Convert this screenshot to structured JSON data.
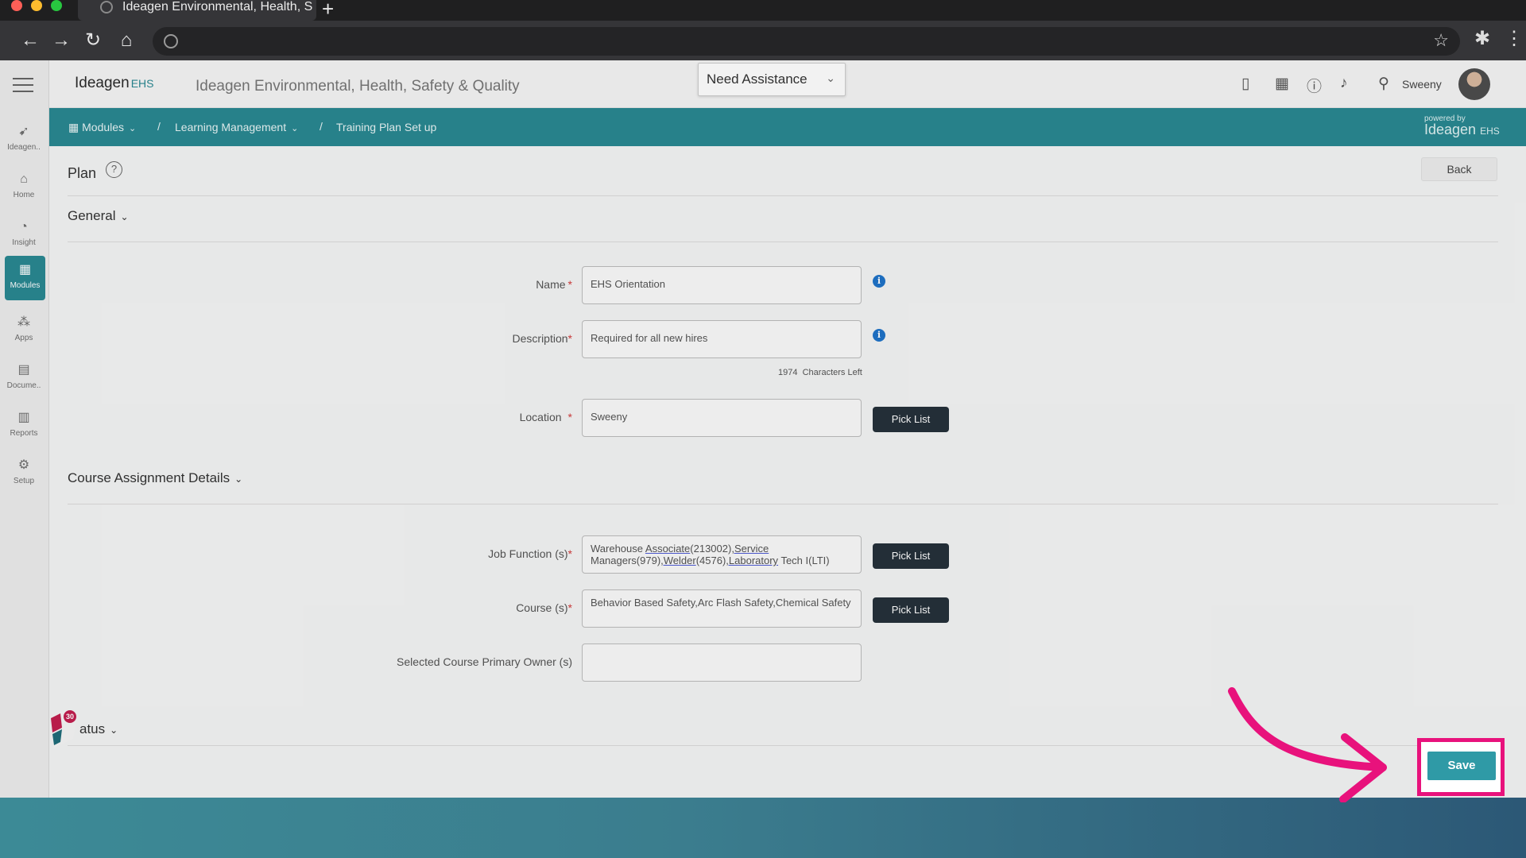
{
  "browser": {
    "tab_title": "Ideagen Environmental, Health, S",
    "new_tab_label": "+"
  },
  "header": {
    "logo_text": "Ideagen",
    "logo_suffix": "EHS",
    "app_title": "Ideagen Environmental, Health, Safety & Quality",
    "assistance_label": "Need Assistance",
    "user_name": "Sweeny"
  },
  "sidebar": {
    "items": [
      {
        "label": "Ideagen..",
        "icon": "ideagen-icon"
      },
      {
        "label": "Home",
        "icon": "home-icon"
      },
      {
        "label": "Insight",
        "icon": "insight-icon"
      },
      {
        "label": "Modules",
        "icon": "modules-icon"
      },
      {
        "label": "Apps",
        "icon": "apps-icon"
      },
      {
        "label": "Docume..",
        "icon": "document-icon"
      },
      {
        "label": "Reports",
        "icon": "reports-icon"
      },
      {
        "label": "Setup",
        "icon": "setup-icon"
      }
    ],
    "active_index": 3
  },
  "breadcrumb": {
    "items": [
      "Modules",
      "Learning Management",
      "Training Plan Set up"
    ],
    "separator": "/",
    "powered_small": "powered by",
    "powered_brand": "Ideagen",
    "powered_suffix": "EHS"
  },
  "page": {
    "title": "Plan",
    "help": "?",
    "back_label": "Back"
  },
  "sections": {
    "general": "General",
    "course_assignment": "Course Assignment Details",
    "status": "atus"
  },
  "form": {
    "name": {
      "label": "Name",
      "value": "EHS Orientation"
    },
    "description": {
      "label": "Description",
      "value": "Required for all new hires",
      "chars_left": "1974",
      "chars_left_label": "Characters Left"
    },
    "location": {
      "label": "Location",
      "value": "Sweeny"
    },
    "job_function": {
      "label": "Job Function (s)",
      "value_parts": [
        "Warehouse ",
        "Associate",
        "(213002)",
        ",Service",
        " Managers(979)",
        ",Welder",
        "(4576)",
        ",Laboratory",
        " Tech I(LTI)"
      ]
    },
    "course": {
      "label": "Course (s)",
      "value": "Behavior Based Safety,Arc Flash Safety,Chemical Safety"
    },
    "primary_owner": {
      "label": "Selected Course Primary Owner (s)",
      "value": ""
    },
    "pick_list_label": "Pick List",
    "required_mark": "*",
    "info_glyph": "i"
  },
  "walkme": {
    "badge": "30"
  },
  "actions": {
    "save_label": "Save"
  },
  "colors": {
    "teal": "#2a8892",
    "dark_button": "#25313a",
    "highlight": "#e8127c",
    "required": "#d23b3b"
  }
}
